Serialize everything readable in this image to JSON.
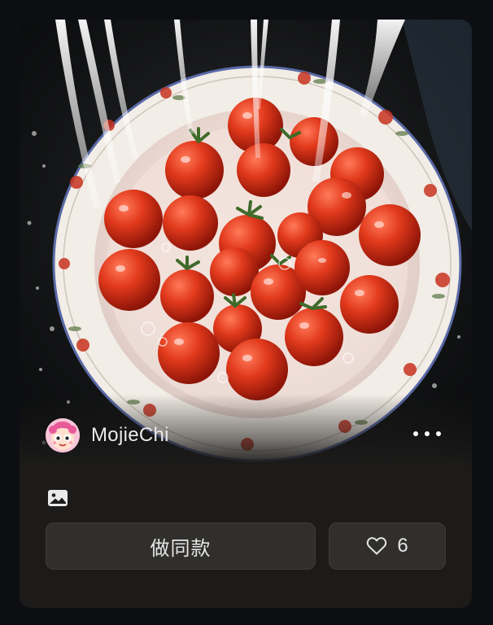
{
  "card": {
    "author": {
      "name": "MojieChi"
    },
    "actions": {
      "make_same_label": "做同款",
      "like_count": "6"
    },
    "icons": {
      "more": "more-horizontal-icon",
      "media_type": "image-icon",
      "like": "heart-outline-icon"
    }
  },
  "colors": {
    "page_bg": "#0c0e12",
    "card_bg": "#1c1b1a",
    "button_bg": "#302f2d",
    "text": "#e6e6e6"
  }
}
